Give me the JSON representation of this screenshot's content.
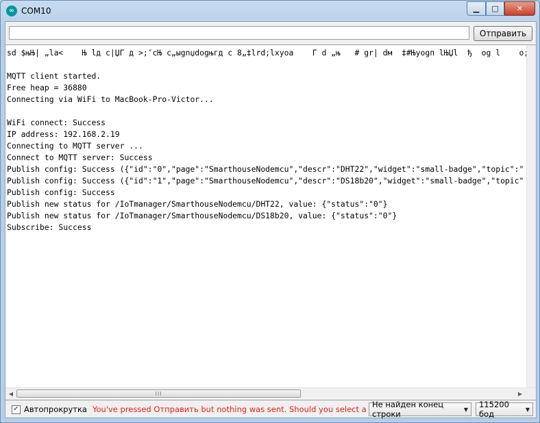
{
  "window": {
    "title": "COM10",
    "app_icon_glyph": "∞",
    "min_glyph": "▁",
    "max_glyph": "□",
    "close_glyph": "✕"
  },
  "send": {
    "input_value": "",
    "button_label": "Отправить"
  },
  "console": {
    "lines": [
      "sd $њЊ| „la<    Њ lд c|ЏГ д >;″cЊ c„ыgnџdogњгд c 8„‡lrd;lxyoa    Г d „њ   # gr| dм  ‡#Њyogп lЊЏl  ђ  og l    o;‡>Њg",
      "",
      "MQTT client started.",
      "Free heap = 36880",
      "Connecting via WiFi to MacBook-Pro-Victor...",
      "",
      "WiFi connect: Success",
      "IP address: 192.168.2.19",
      "Connecting to MQTT server ...",
      "Connect to MQTT server: Success",
      "Publish config: Success ({\"id\":\"0\",\"page\":\"SmarthouseNodemcu\",\"descr\":\"DHT22\",\"widget\":\"small-badge\",\"topic\":\"",
      "Publish config: Success ({\"id\":\"1\",\"page\":\"SmarthouseNodemcu\",\"descr\":\"DS18b20\",\"widget\":\"small-badge\",\"topic\"",
      "Publish config: Success",
      "Publish new status for /IoTmanager/SmarthouseNodemcu/DHT22, value: {\"status\":\"0\"}",
      "Publish new status for /IoTmanager/SmarthouseNodemcu/DS18b20, value: {\"status\":\"0\"}",
      "Subscribe: Success"
    ]
  },
  "scrollbar": {
    "left_arrow": "◀",
    "right_arrow": "▶",
    "thumb_grip": "III"
  },
  "status": {
    "autoscroll_label": "Автопрокрутка",
    "autoscroll_checked": true,
    "check_glyph": "✓",
    "warning_text": "You've pressed Отправить but nothing was sent. Should you select a line ending?",
    "line_ending_value": "Не найден конец строки",
    "baud_value": "115200 бод",
    "dropdown_glyph": "▼"
  }
}
